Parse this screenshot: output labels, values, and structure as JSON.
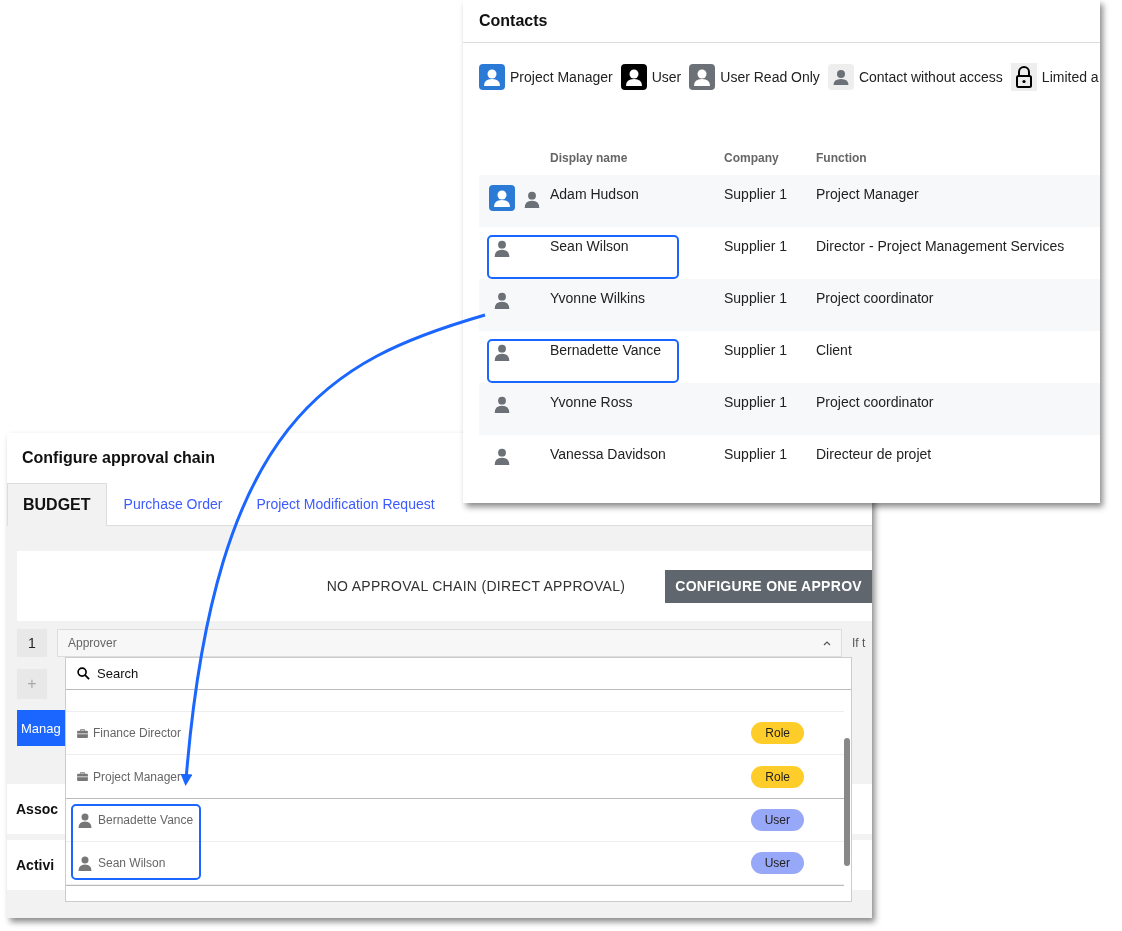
{
  "contacts": {
    "title": "Contacts",
    "legend": [
      {
        "kind": "project_manager",
        "label": "Project Manager"
      },
      {
        "kind": "user",
        "label": "User"
      },
      {
        "kind": "read_only",
        "label": "User Read Only"
      },
      {
        "kind": "contact",
        "label": "Contact without access"
      },
      {
        "kind": "limited",
        "label": "Limited a"
      }
    ],
    "columns": [
      "Display name",
      "Company",
      "Function"
    ],
    "rows": [
      {
        "badges": [
          {
            "kind": "project_manager"
          },
          {
            "kind": "contact"
          }
        ],
        "name": "Adam Hudson",
        "company": "Supplier 1",
        "function": "Project Manager",
        "highlighted": false
      },
      {
        "badges": [
          {
            "kind": "contact"
          }
        ],
        "name": "Sean Wilson",
        "company": "Supplier 1",
        "function": "Director - Project Management Services",
        "highlighted": true
      },
      {
        "badges": [
          {
            "kind": "contact"
          }
        ],
        "name": "Yvonne Wilkins",
        "company": "Supplier 1",
        "function": "Project coordinator",
        "highlighted": false
      },
      {
        "badges": [
          {
            "kind": "contact"
          }
        ],
        "name": "Bernadette Vance",
        "company": "Supplier 1",
        "function": "Client",
        "highlighted": true
      },
      {
        "badges": [
          {
            "kind": "contact"
          }
        ],
        "name": "Yvonne Ross",
        "company": "Supplier 1",
        "function": "Project coordinator",
        "highlighted": false
      },
      {
        "badges": [
          {
            "kind": "contact"
          }
        ],
        "name": "Vanessa Davidson",
        "company": "Supplier 1",
        "function": "Directeur de projet",
        "highlighted": false
      }
    ]
  },
  "approval": {
    "title": "Configure approval chain",
    "tabs": [
      {
        "label": "BUDGET",
        "selected": true
      },
      {
        "label": "Purchase Order",
        "selected": false
      },
      {
        "label": "Project Modification Request",
        "selected": false
      }
    ],
    "status_text": "NO APPROVAL CHAIN (DIRECT APPROVAL)",
    "configure_button": "CONFIGURE ONE APPROV",
    "step_number": "1",
    "approver_select": {
      "placeholder": "Approver",
      "expanded": true
    },
    "side_text": "If t",
    "add_button": "+",
    "manage_button": "Manag",
    "sections": [
      "Assoc",
      "Activi"
    ],
    "dropdown": {
      "search_placeholder": "Search",
      "groups": [
        {
          "kind": "role",
          "highlighted": false,
          "items": [
            {
              "label": "Finance Director",
              "badge": "Role"
            },
            {
              "label": "Project Manager",
              "badge": "Role"
            }
          ]
        },
        {
          "kind": "user",
          "highlighted": true,
          "items": [
            {
              "label": "Bernadette Vance",
              "badge": "User"
            },
            {
              "label": "Sean Wilson",
              "badge": "User"
            }
          ]
        }
      ]
    }
  }
}
